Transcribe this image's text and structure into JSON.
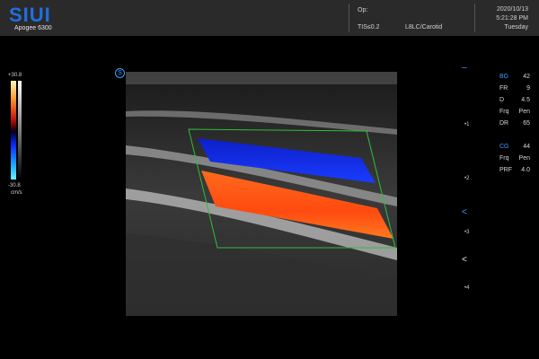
{
  "header": {
    "brand": "SIUI",
    "model": "Apogee 6300",
    "op_label": "Op:",
    "tis": "TIS≤0.2",
    "probe_preset": "L8LC/Carotid",
    "date": "2020/10/13",
    "time": "5:21:28 PM",
    "day": "Tuesday"
  },
  "color_scale": {
    "max": "+30.8",
    "min": "-30.8",
    "unit": "cm/s"
  },
  "probe_icon": "S",
  "depth_scale": [
    "1",
    "2",
    "3",
    "4"
  ],
  "markers": {
    "focus_top": "–",
    "focus": "<",
    "focus2": "<"
  },
  "bmode": {
    "title": "BG",
    "bg_value": "42",
    "params": [
      {
        "label": "FR",
        "value": "9"
      },
      {
        "label": "D",
        "value": "4.5"
      },
      {
        "label": "Frq",
        "value": "Pen"
      },
      {
        "label": "DR",
        "value": "65"
      }
    ]
  },
  "colormode": {
    "title": "CG",
    "cg_value": "44",
    "params": [
      {
        "label": "Frq",
        "value": "Pen"
      },
      {
        "label": "PRF",
        "value": "4.0"
      }
    ]
  },
  "colors": {
    "accent": "#3aa0ff",
    "logo": "#1f6fe0",
    "roi_box": "#2fbf3a",
    "vessel_red": "#ff5a1a",
    "vessel_blue": "#1430e0"
  }
}
